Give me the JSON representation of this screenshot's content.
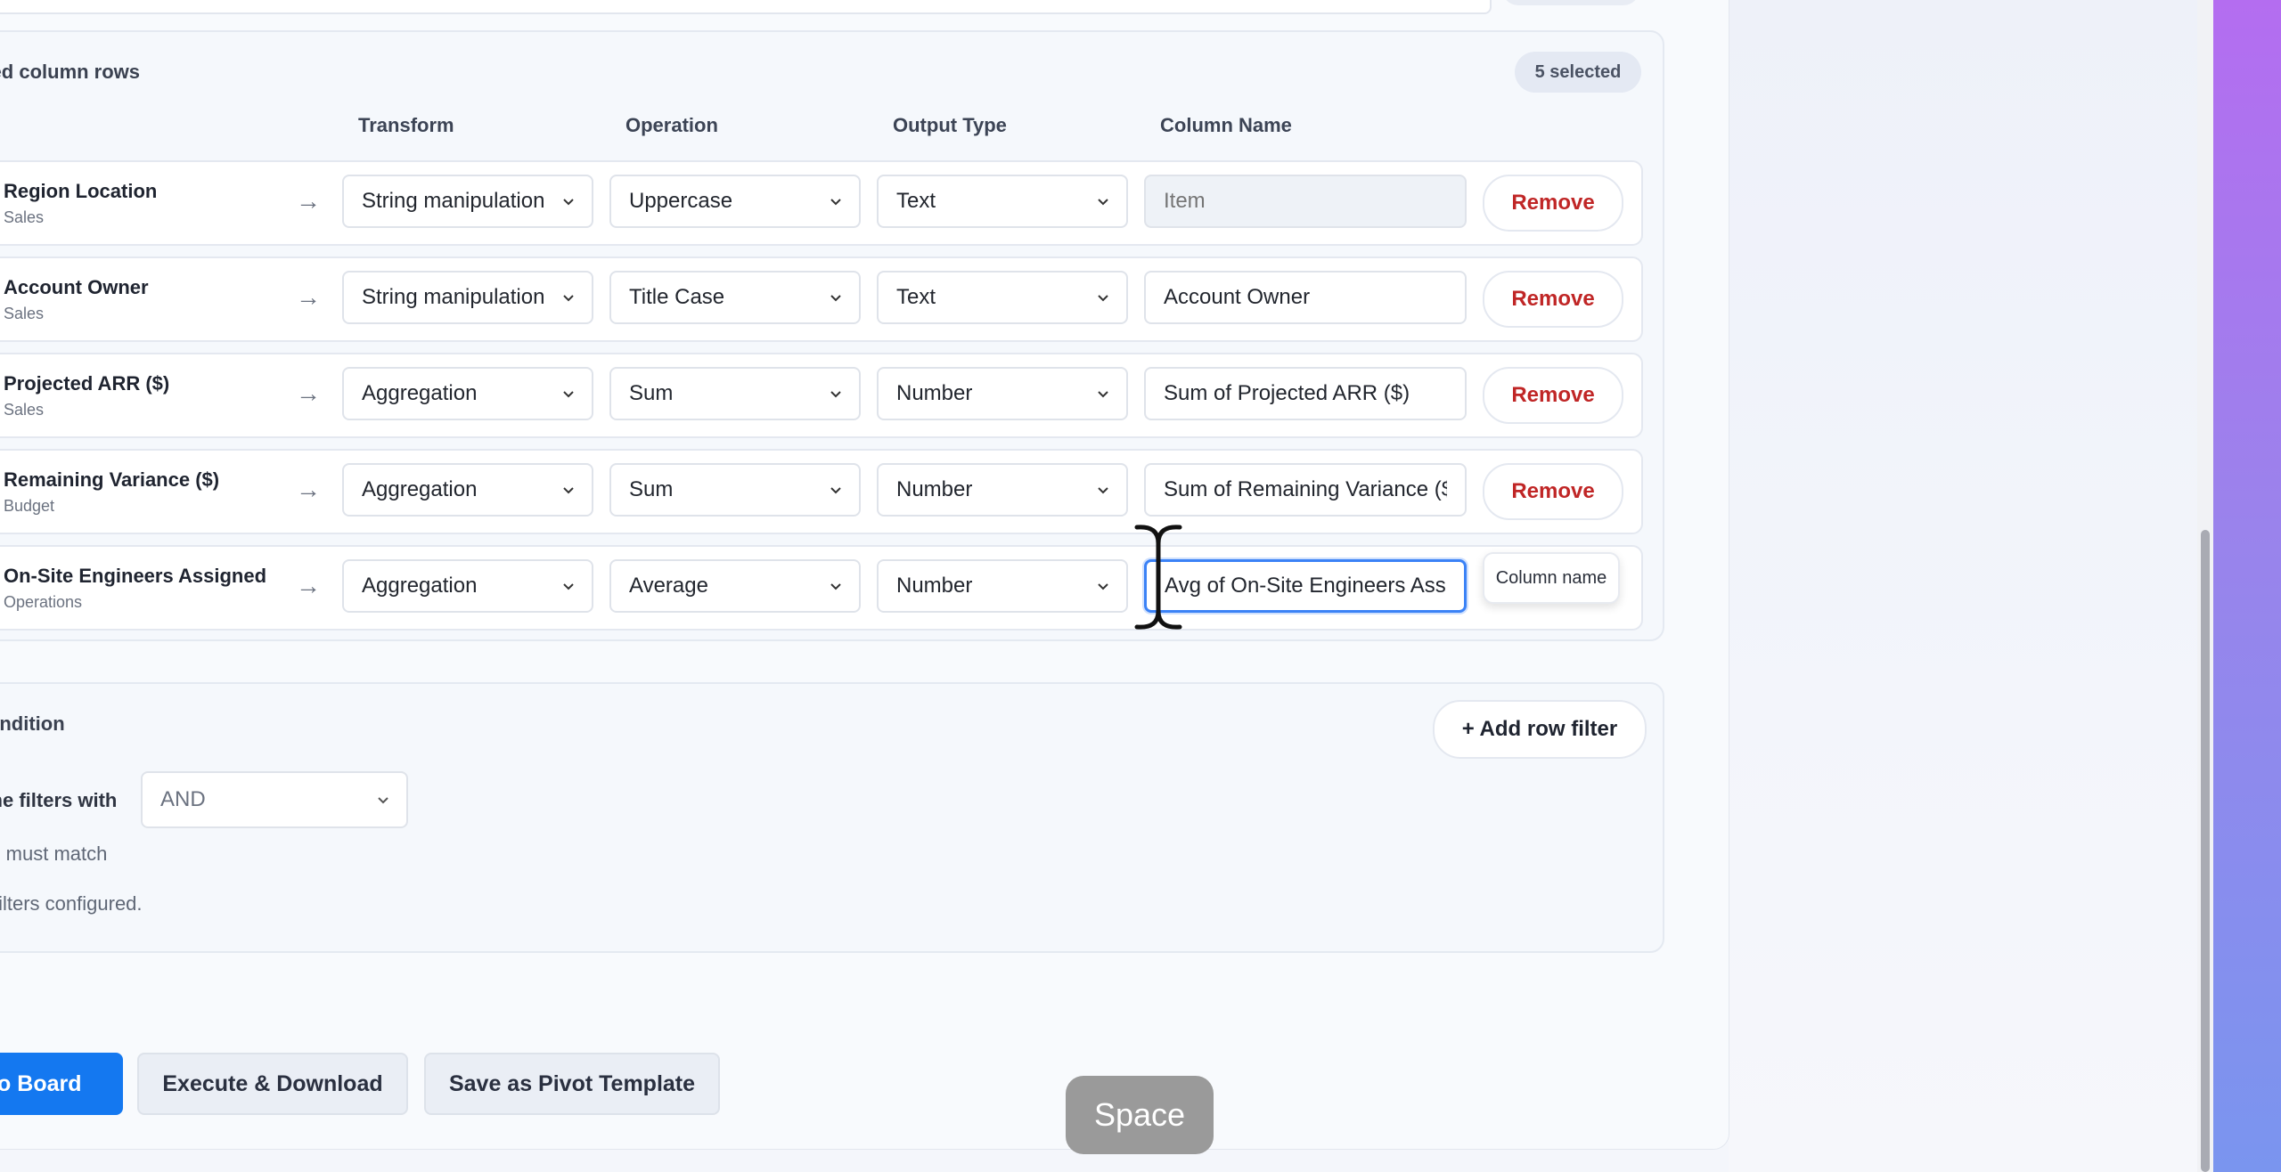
{
  "columns_section": {
    "title": "cted column rows",
    "selected_badge": "5 selected",
    "headers": {
      "transform": "Transform",
      "operation": "Operation",
      "output_type": "Output Type",
      "column_name": "Column Name"
    },
    "rows": [
      {
        "name": "Region Location",
        "source": "Sales",
        "transform": "String manipulation",
        "operation": "Uppercase",
        "output": "Text",
        "column_name": "",
        "placeholder": "Item",
        "action": "Remove"
      },
      {
        "name": "Account Owner",
        "source": "Sales",
        "transform": "String manipulation",
        "operation": "Title Case",
        "output": "Text",
        "column_name": "Account Owner",
        "placeholder": "",
        "action": "Remove"
      },
      {
        "name": "Projected ARR ($)",
        "source": "Sales",
        "transform": "Aggregation",
        "operation": "Sum",
        "output": "Number",
        "column_name": "Sum of Projected ARR ($)",
        "placeholder": "",
        "action": "Remove"
      },
      {
        "name": "Remaining Variance ($)",
        "source": "Budget",
        "transform": "Aggregation",
        "operation": "Sum",
        "output": "Number",
        "column_name": "Sum of Remaining Variance ($)",
        "placeholder": "",
        "action": "Remove"
      },
      {
        "name": "On-Site Engineers Assigned",
        "source": "Operations",
        "transform": "Aggregation",
        "operation": "Average",
        "output": "Number",
        "column_name": "Avg of On-Site Engineers Assigned",
        "placeholder": "",
        "action": "Column name"
      }
    ],
    "arrow": "→"
  },
  "tooltip": "Column name",
  "condition_section": {
    "title": "Condition",
    "add_filter": "+ Add row filter",
    "combine_label": "oine filters with",
    "combine_value": "AND",
    "must_match": "ers must match",
    "no_filters": "w filters configured."
  },
  "footer": {
    "add_to_board": "d to Board",
    "execute": "Execute & Download",
    "save_template": "Save as Pivot Template"
  },
  "key_hint": "Space",
  "colors": {
    "primary": "#1478f0",
    "danger": "#c02626",
    "focus": "#3b82f6"
  }
}
